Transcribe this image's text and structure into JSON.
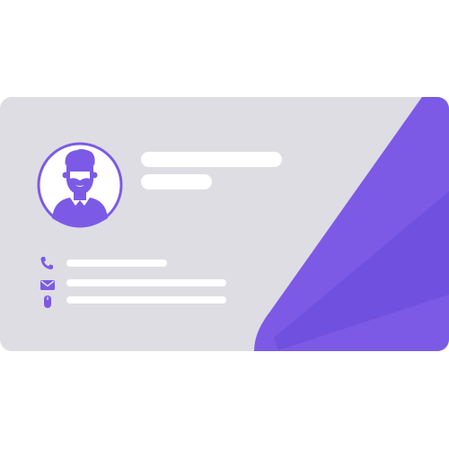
{
  "business_card": {
    "accent_color": "#7c5ae6",
    "accent_dark_color": "#6f4fdc",
    "card_color": "#dedde3",
    "placeholder_color": "#ffffff",
    "avatar_icon": "user-avatar-icon",
    "contact_icons": [
      "phone-icon",
      "mail-icon",
      "mouse-icon"
    ]
  }
}
